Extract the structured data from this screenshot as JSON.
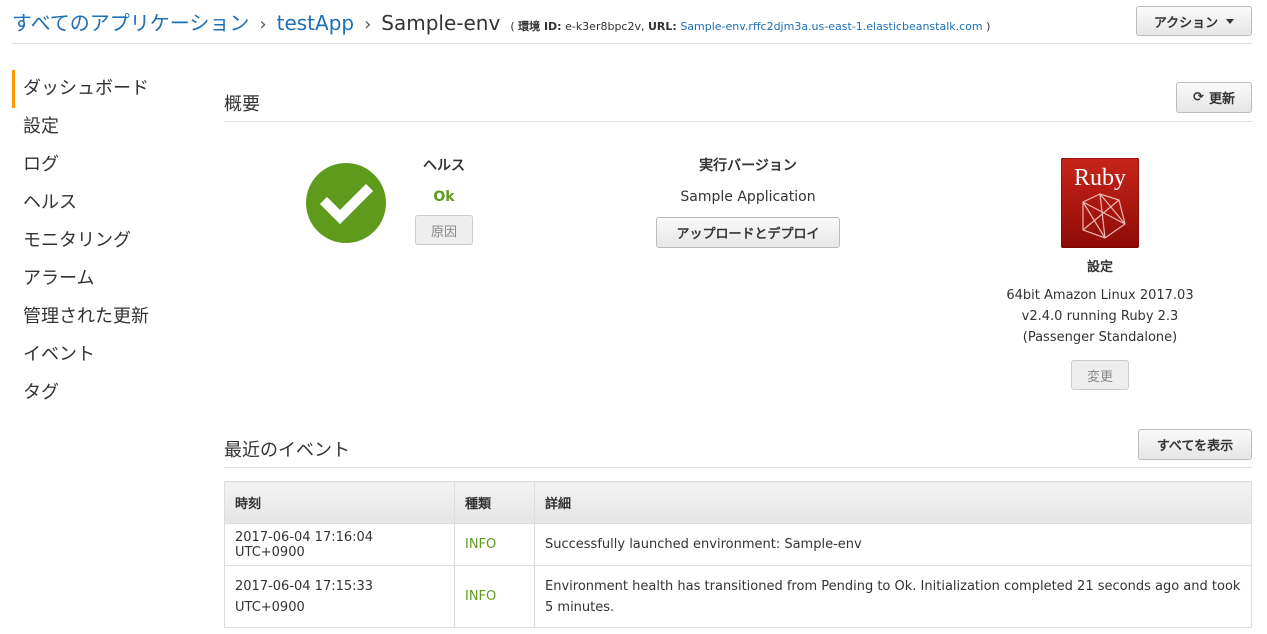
{
  "breadcrumb": {
    "root": "すべてのアプリケーション",
    "app": "testApp",
    "env": "Sample-env",
    "meta_prefix": "( ",
    "env_id_label": "環境 ID:",
    "env_id": "e-k3er8bpc2v,",
    "url_label": "URL:",
    "url": "Sample-env.rffc2djm3a.us-east-1.elasticbeanstalk.com",
    "meta_suffix": " )"
  },
  "header": {
    "action_label": "アクション"
  },
  "sidebar": {
    "items": [
      {
        "label": "ダッシュボード"
      },
      {
        "label": "設定"
      },
      {
        "label": "ログ"
      },
      {
        "label": "ヘルス"
      },
      {
        "label": "モニタリング"
      },
      {
        "label": "アラーム"
      },
      {
        "label": "管理された更新"
      },
      {
        "label": "イベント"
      },
      {
        "label": "タグ"
      }
    ]
  },
  "overview": {
    "title": "概要",
    "refresh_label": "更新",
    "health": {
      "label": "ヘルス",
      "value": "Ok",
      "cause_label": "原因"
    },
    "version": {
      "label": "実行バージョン",
      "value": "Sample Application",
      "deploy_label": "アップロードとデプロイ"
    },
    "config": {
      "logo_text": "Ruby",
      "label": "設定",
      "lines": [
        "64bit Amazon Linux 2017.03",
        "v2.4.0 running Ruby 2.3",
        "(Passenger Standalone)"
      ],
      "change_label": "変更"
    },
    "colors": {
      "health_green": "#5e9b1c",
      "ruby_red": "#b5150e"
    },
    "icons": {
      "health": "check-circle-icon",
      "refresh": "refresh-icon"
    }
  },
  "events": {
    "title": "最近のイベント",
    "show_all_label": "すべてを表示",
    "headers": [
      "時刻",
      "種類",
      "詳細"
    ],
    "rows": [
      {
        "time": "2017-06-04 17:16:04 UTC+0900",
        "type": "INFO",
        "detail": "Successfully launched environment: Sample-env"
      },
      {
        "time": "2017-06-04 17:15:33 UTC+0900",
        "type": "INFO",
        "detail": "Environment health has transitioned from Pending to Ok. Initialization completed 21 seconds ago and took 5 minutes."
      }
    ]
  }
}
